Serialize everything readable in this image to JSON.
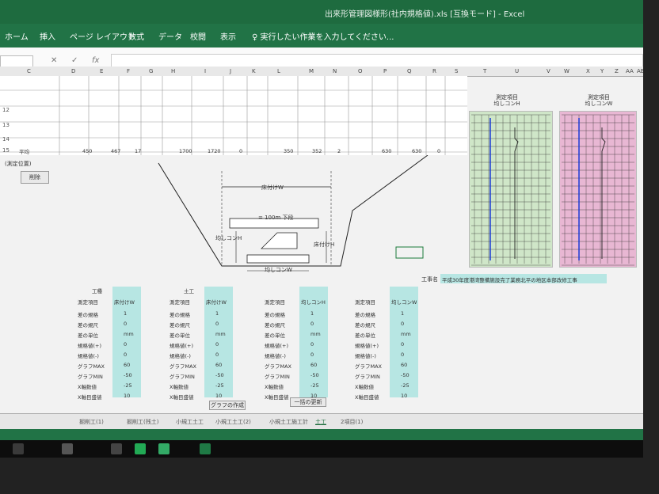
{
  "window": {
    "title": "出来形管理図様形(社内規格値).xls [互換モード] - Excel"
  },
  "ribbon": {
    "tabs": [
      "ホーム",
      "挿入",
      "ページ レイアウト",
      "数式",
      "データ",
      "校閲",
      "表示"
    ],
    "tell_me": "実行したい作業を入力してください..."
  },
  "formula_bar": {
    "fx": "fx"
  },
  "columns": [
    "C",
    "D",
    "E",
    "F",
    "G",
    "H",
    "I",
    "J",
    "K",
    "L",
    "M",
    "N",
    "O",
    "P",
    "Q",
    "R",
    "S",
    "T",
    "U",
    "V",
    "W",
    "X",
    "Y",
    "Z",
    "AA",
    "AB"
  ],
  "rows": [
    "12",
    "13",
    "14",
    "15"
  ],
  "summary_row": {
    "label": "平均",
    "values": [
      "450",
      "467",
      "17",
      "1700",
      "1720",
      "0",
      "350",
      "352",
      "2",
      "630",
      "630",
      "0"
    ]
  },
  "measure_position": "(測定位置)",
  "delete_button": "削除",
  "diagram": {
    "top_width": "床付けW",
    "pipe": "= 100m 下段",
    "height_left": "均しコンH",
    "height_right": "床付けH",
    "bottom_width": "均しコンW"
  },
  "charts": [
    {
      "title1": "測定項目",
      "title2": "均しコンH",
      "color": "#7a7"
    },
    {
      "title1": "測定項目",
      "title2": "均しコンW",
      "color": "#a57"
    }
  ],
  "work_name_label": "工事名",
  "work_name": "平成30年度港湾整備施設完了業務北平の地区本部改修工事",
  "panels": [
    {
      "head": "工種",
      "item": "測定項目",
      "val": "床付けW"
    },
    {
      "head": "土工",
      "item": "測定項目",
      "val": "床付けW"
    },
    {
      "head": "",
      "item": "測定項目",
      "val": "均しコンH"
    },
    {
      "head": "",
      "item": "測定項目",
      "val": "均しコンW"
    }
  ],
  "panel_rows": [
    "差の規格",
    "差の規尺",
    "差の単位",
    "規格値(+)",
    "規格値(-)",
    "グラフMAX",
    "グラフMIN",
    "X軸数値",
    "X軸目盛値"
  ],
  "panel_values": [
    "1",
    "0",
    "mm",
    "0",
    "0",
    "60",
    "-50",
    "-25",
    "10"
  ],
  "graph_button": "グラフの作成",
  "update_button": "一括の更新",
  "sheet_tabs": [
    "掘削工(1)",
    "掘削工(残土)",
    "小規工土工",
    "小規工土工(2)",
    "小規土工施工計",
    "土工",
    "2項目(1)"
  ],
  "colors": {
    "excel_green": "#217346",
    "cyan": "#b7e6e3",
    "green_chart": "#cfe6c8",
    "pink_chart": "#e8b7d3"
  }
}
